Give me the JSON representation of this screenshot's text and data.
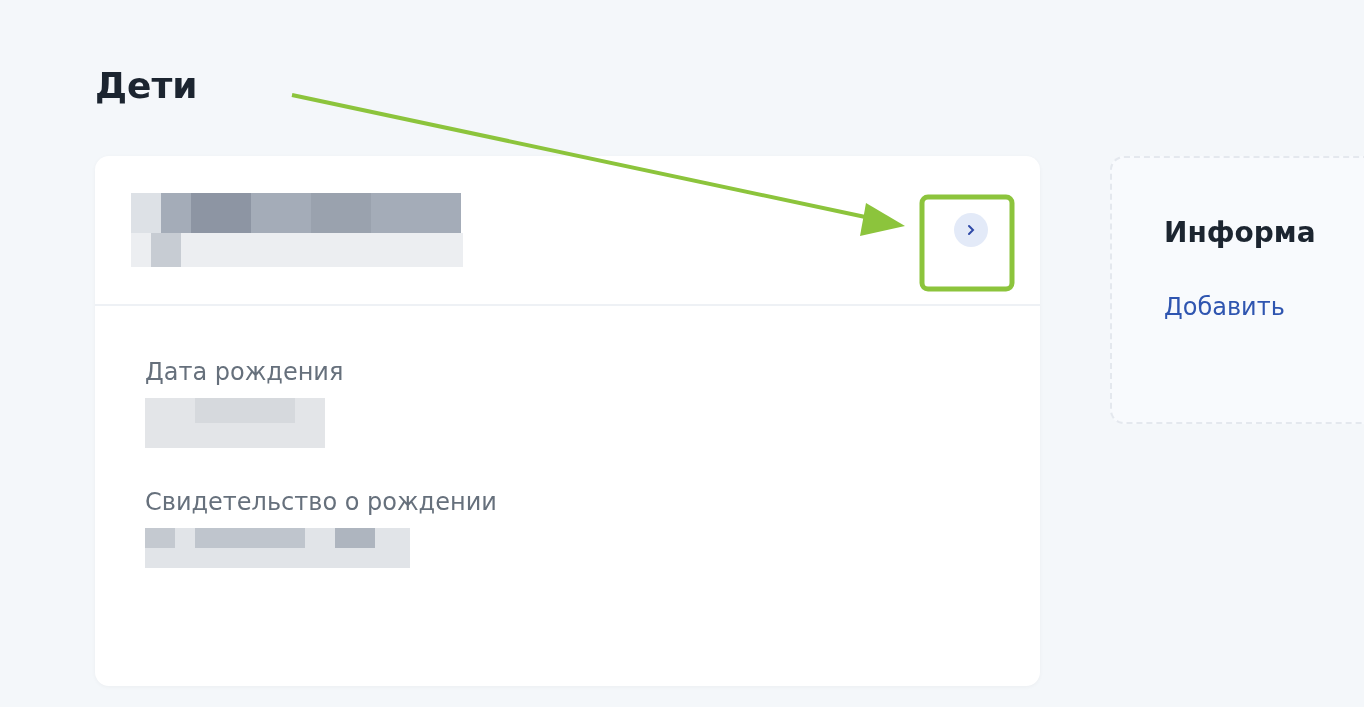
{
  "page_title": "Дети",
  "child_card": {
    "fields": [
      {
        "label": "Дата рождения"
      },
      {
        "label": "Свидетельство о рождении"
      }
    ]
  },
  "info_card": {
    "title": "Информа",
    "link": "Добавить"
  }
}
